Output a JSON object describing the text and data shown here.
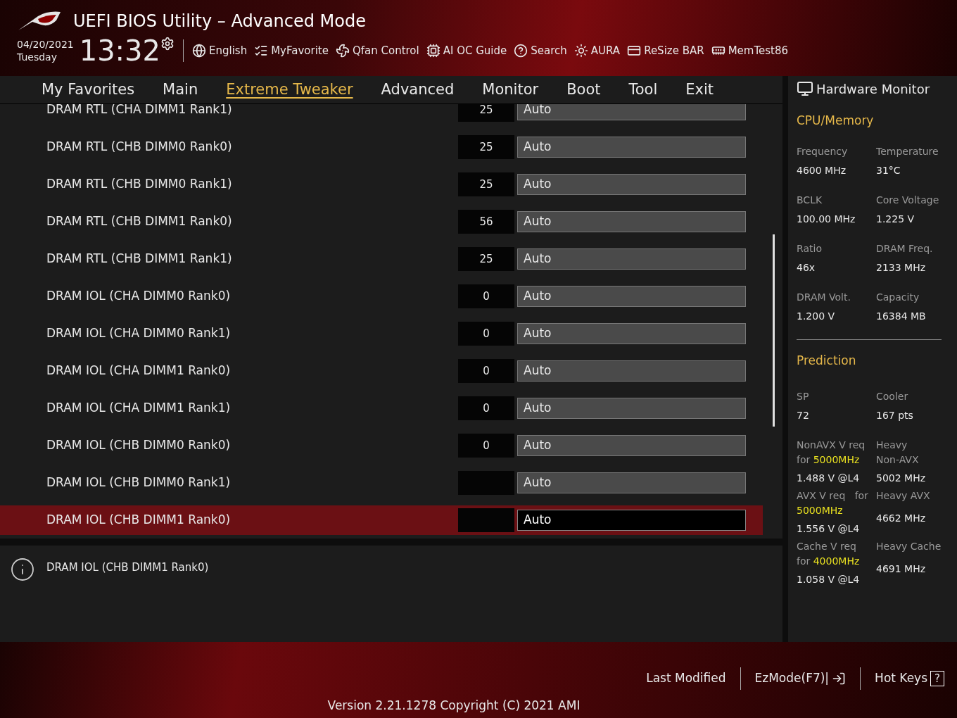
{
  "window": {
    "title": "UEFI BIOS Utility – Advanced Mode"
  },
  "status": {
    "date": "04/20/2021",
    "day": "Tuesday",
    "time": "13:32"
  },
  "toolbar": [
    {
      "label": "English"
    },
    {
      "label": "MyFavorite"
    },
    {
      "label": "Qfan Control"
    },
    {
      "label": "AI OC Guide"
    },
    {
      "label": "Search"
    },
    {
      "label": "AURA"
    },
    {
      "label": "ReSize BAR"
    },
    {
      "label": "MemTest86"
    }
  ],
  "tabs": [
    {
      "label": "My Favorites",
      "selected": false
    },
    {
      "label": "Main",
      "selected": false
    },
    {
      "label": "Extreme Tweaker",
      "selected": true
    },
    {
      "label": "Advanced",
      "selected": false
    },
    {
      "label": "Monitor",
      "selected": false
    },
    {
      "label": "Boot",
      "selected": false
    },
    {
      "label": "Tool",
      "selected": false
    },
    {
      "label": "Exit",
      "selected": false
    }
  ],
  "settings": [
    {
      "name": "DRAM RTL (CHA DIMM1 Rank1)",
      "reading": "25",
      "value": "Auto",
      "selected": false
    },
    {
      "name": "DRAM RTL (CHB DIMM0 Rank0)",
      "reading": "25",
      "value": "Auto",
      "selected": false
    },
    {
      "name": "DRAM RTL (CHB DIMM0 Rank1)",
      "reading": "25",
      "value": "Auto",
      "selected": false
    },
    {
      "name": "DRAM RTL (CHB DIMM1 Rank0)",
      "reading": "56",
      "value": "Auto",
      "selected": false
    },
    {
      "name": "DRAM RTL (CHB DIMM1 Rank1)",
      "reading": "25",
      "value": "Auto",
      "selected": false
    },
    {
      "name": "DRAM IOL (CHA DIMM0 Rank0)",
      "reading": "0",
      "value": "Auto",
      "selected": false
    },
    {
      "name": "DRAM IOL (CHA DIMM0 Rank1)",
      "reading": "0",
      "value": "Auto",
      "selected": false
    },
    {
      "name": "DRAM IOL (CHA DIMM1 Rank0)",
      "reading": "0",
      "value": "Auto",
      "selected": false
    },
    {
      "name": "DRAM IOL (CHA DIMM1 Rank1)",
      "reading": "0",
      "value": "Auto",
      "selected": false
    },
    {
      "name": "DRAM IOL (CHB DIMM0 Rank0)",
      "reading": "0",
      "value": "Auto",
      "selected": false
    },
    {
      "name": "DRAM IOL (CHB DIMM0 Rank1)",
      "value": "Auto",
      "selected": false
    },
    {
      "name": "DRAM IOL (CHB DIMM1 Rank0)",
      "value": "Auto",
      "selected": true
    }
  ],
  "help": {
    "text": "DRAM IOL (CHB DIMM1 Rank0)"
  },
  "hardware_monitor": {
    "title": "Hardware Monitor",
    "cpu_memory": {
      "title": "CPU/Memory",
      "items": [
        {
          "label": "Frequency",
          "value": "4600 MHz"
        },
        {
          "label": "Temperature",
          "value": "31°C"
        },
        {
          "label": "BCLK",
          "value": "100.00 MHz"
        },
        {
          "label": "Core Voltage",
          "value": "1.225 V"
        },
        {
          "label": "Ratio",
          "value": "46x"
        },
        {
          "label": "DRAM Freq.",
          "value": "2133 MHz"
        },
        {
          "label": "DRAM Volt.",
          "value": "1.200 V"
        },
        {
          "label": "Capacity",
          "value": "16384 MB"
        }
      ]
    },
    "prediction": {
      "title": "Prediction",
      "items": [
        {
          "label": "SP",
          "value": "72"
        },
        {
          "label": "Cooler",
          "value": "167 pts"
        }
      ],
      "requirements": [
        {
          "line1": "NonAVX V req",
          "prefix": "for",
          "highlight": "5000MHz",
          "value": "1.488 V @L4",
          "right_label": [
            "Heavy",
            "Non-AVX"
          ],
          "right_value": "5002 MHz"
        },
        {
          "line1": "AVX V req   for",
          "highlight": "5000MHz",
          "value": "1.556 V @L4",
          "right_label": [
            "Heavy AVX"
          ],
          "right_value": "4662 MHz"
        },
        {
          "line1": "Cache V req",
          "prefix": "for",
          "highlight": "4000MHz",
          "value": "1.058 V @L4",
          "right_label": [
            "Heavy Cache"
          ],
          "right_value": "4691 MHz"
        }
      ]
    }
  },
  "footer": {
    "last_modified": "Last Modified",
    "ezmode": "EzMode(F7)|",
    "hotkeys": "Hot Keys",
    "hotkeys_key": "?",
    "version": "Version 2.21.1278 Copyright (C) 2021 AMI"
  }
}
